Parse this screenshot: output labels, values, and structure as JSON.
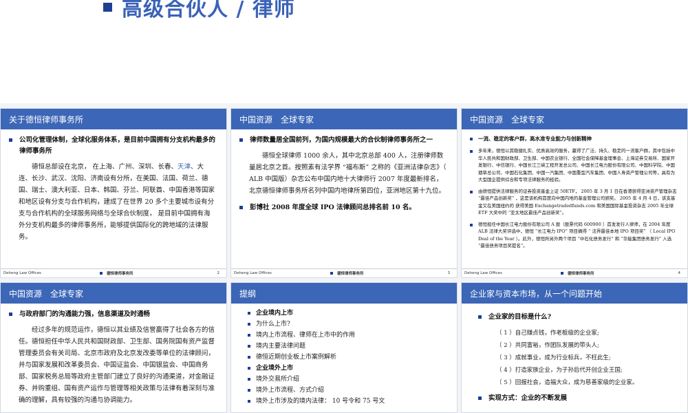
{
  "banner": {
    "title": "高级合伙人 / 律师"
  },
  "footer": {
    "left": "Deheng Law Offices",
    "center": "德恒律师事务所"
  },
  "slides": [
    {
      "header": "关于德恒律师事务所",
      "page": "2",
      "bullet": "公司化管理体制，全球化服务体系，是目前中国拥有分支机构最多的律师事务所",
      "para_a": "德恒总部设在北京， 在上海、广州、深圳、长春、",
      "para_hl": "天津",
      "para_b": "、大连、长沙、武汉、沈阳、济南设有分所，在美国、法国、荷兰、德国、瑞士、澳大利亚、日本、韩国、芬兰、阿联酋、中国香港等国家和地区设有分支与合作机构，建成了在世界 20 多个主要城市设有分支与合作机构的全球服务网络与全球合伙制度， 是目前中国拥有海外分支机构最多的律师事务所，能够提供国际化的跨地域的法律服务。"
    },
    {
      "header": "中国资源　全球专家",
      "page": "3",
      "bullet1": "律师数量居全国前列，为国内规模最大的合伙制律师事务所之一",
      "para": "德恒全球律师 1000 余人，其中北京总部 400 人，注册律师数量居北京之首。按照素有法学界 “福布斯” 之称的《亚洲法律杂志》（ ALB 中国版）杂志公布中国内地十大律师行 2007 年度最新排名，北京德恒律师事务所名列中国内地律所第四位，亚洲地区第十九位。",
      "bullet2": "彭博社 2008 年度全球 IPO 法律顾问总排名前 10 名。"
    },
    {
      "header": "中国资源　全球专家",
      "page": "4",
      "bullet1": "一流、稳定的客户群，高水准专业能力与创新精神",
      "bullet2": "多年来，德恒以其稳健扎实、优质高效的服务，赢得了广泛、持久、稳定的一流客户群，其中包括中华人民共和国财政部、卫生部、中国农业银行、全国社会保障基金理事会、上海证券交易所、国家开发银行、中信银行、中国长江三峡工程开发总公司、中国长江电力股份有限公司、中国科学院、中国烟草总公司、中国石化集团、中国一汽集团、中国重型汽车集团、中国人寿资产管理公司等，具有为大型国企提供综合和专项法律服务的经验。",
      "bullet3": "由德恒提供法律服务的证券投资基金上证 50ETF， 2005 年 3 月 1 日在香港获得亚洲资产管理杂志 “最佳产品创新奖” ，这是该机构首度向中国内地的基金管理公司颁奖。 2005 年 4 月 4 日，该支基金又在美国纽约的 获得美国 Exchangetradedfunds.com 和美国国际基金投资杂志 2005 年全球 ETF 大奖中的 “亚太地区最佳产品创新奖”。",
      "bullet4": "德恒担任中国长江电力股份有限公司 A 股（股票代码 600900 ）首发发行人律师，在 2004 年度 ALB 法律大奖评选中，德恒 “长江电力 IPO” 项目摘得 “ 法界最佳本地 IPO 项目奖” （ Local IPO Deal of the Year ）。此外，德恒所另外两个项目 “中石化债务发行” 和 “华能集团债务发行” 入选 “最佳债务项目奖提名”。"
    },
    {
      "header": "中国资源　全球专家",
      "bullet": "与政府部门的沟通能力强，信息渠道及时通畅",
      "para": "经过多年的规范运作，德恒以其业绩及信誉赢得了社会各方的信任。德恒担任中华人民共和国财政部、卫生部、国务院国有资产监督管理委员会有关司局、北京市政府及北京发改委等单位的法律顾问，并与国家发展和改革委员会、中国证监会、中国银监会、中国商务部、国家税务总局等政府主管部门建立了良好的沟通渠道，对金融证券、并购重组、国有资产运作与管理等相关政策与法律有着深刻与准确的理解，具有较强的沟通与协调能力。"
    },
    {
      "header": "提纲",
      "items": [
        {
          "text": "企业境内上市",
          "main": true
        },
        {
          "text": "为什么上市?",
          "main": false
        },
        {
          "text": "境内上市流程、律师在上市中的作用",
          "main": false
        },
        {
          "text": "境内主要法律问题",
          "main": false
        },
        {
          "text": "德恒近期创业板上市案例解析",
          "main": false
        },
        {
          "text": "企业境外上市",
          "main": true
        },
        {
          "text": "境外交易所介绍",
          "main": false
        },
        {
          "text": "境外上市流程、方式介绍",
          "main": false
        },
        {
          "text": "境外上市涉及的境内法律： 10 号令和 75 号文",
          "main": false
        }
      ]
    },
    {
      "header": "企业家与资本市场，从一个问题开始",
      "bullet1": "企业家的目标是什么?",
      "goals": [
        "（ 1 ）自己赚点钱，作老板级的企业家;",
        "（ 2 ）共同富裕，作团队发展的带头人;",
        "（ 3 ）成就事业，成为行业标兵，不枉此生;",
        "（ 4 ）打造家族企业，为子孙后代开创企业王国;",
        "（ 5 ）回报社会，造福大众，成为慈善家级的企业家。"
      ],
      "bullet2": "实现方式：企业的不断发展"
    }
  ]
}
